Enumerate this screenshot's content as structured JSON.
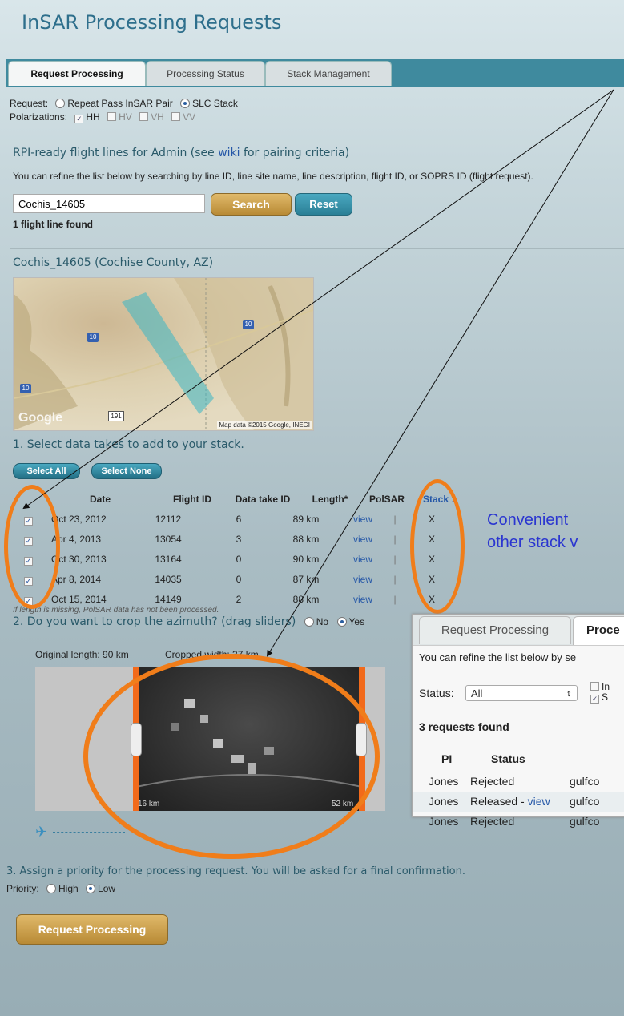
{
  "title": "InSAR Processing Requests",
  "tabs": [
    {
      "label": "Request Processing",
      "active": true
    },
    {
      "label": "Processing Status",
      "active": false
    },
    {
      "label": "Stack Management",
      "active": false
    }
  ],
  "request": {
    "label": "Request:",
    "options": [
      {
        "label": "Repeat Pass InSAR Pair",
        "selected": false
      },
      {
        "label": "SLC Stack",
        "selected": true
      }
    ]
  },
  "polarizations": {
    "label": "Polarizations:",
    "options": [
      {
        "label": "HH",
        "checked": true
      },
      {
        "label": "HV",
        "checked": false
      },
      {
        "label": "VH",
        "checked": false
      },
      {
        "label": "VV",
        "checked": false
      }
    ]
  },
  "flight_lines": {
    "heading_pre": "RPI-ready flight lines for Admin (see ",
    "heading_link": "wiki",
    "heading_post": " for pairing criteria)",
    "help": "You can refine the list below by searching by line ID, line site name, line description, flight ID, or SOPRS ID (flight request).",
    "search_value": "Cochis_14605",
    "search_label": "Search",
    "reset_label": "Reset",
    "found": "1 flight line found"
  },
  "line": {
    "heading": "Cochis_14605 (Cochise County, AZ)",
    "map_attribution": "Map data ©2015 Google, INEGI",
    "map_logo": "Google",
    "highway_10": "10",
    "highway_191": "191"
  },
  "step1": {
    "heading": "1. Select data takes to add to your stack.",
    "select_all": "Select All",
    "select_none": "Select None",
    "columns": [
      "Date",
      "Flight ID",
      "Data take ID",
      "Length*",
      "PolSAR",
      "Stack 1"
    ],
    "rows": [
      {
        "date": "Oct 23, 2012",
        "flight_id": "12112",
        "take_id": "6",
        "length": "89 km",
        "polsar": "view",
        "stack": "X"
      },
      {
        "date": "Apr 4, 2013",
        "flight_id": "13054",
        "take_id": "3",
        "length": "88 km",
        "polsar": "view",
        "stack": "X"
      },
      {
        "date": "Oct 30, 2013",
        "flight_id": "13164",
        "take_id": "0",
        "length": "90 km",
        "polsar": "view",
        "stack": "X"
      },
      {
        "date": "Apr 8, 2014",
        "flight_id": "14035",
        "take_id": "0",
        "length": "87 km",
        "polsar": "view",
        "stack": "X"
      },
      {
        "date": "Oct 15, 2014",
        "flight_id": "14149",
        "take_id": "2",
        "length": "88 km",
        "polsar": "view",
        "stack": "X"
      }
    ],
    "footnote": "If length is missing, PolSAR data has not been processed."
  },
  "step2": {
    "heading": "2. Do you want to crop the azimuth? (drag sliders)",
    "no": "No",
    "yes": "Yes",
    "original_length": "Original length: 90 km",
    "cropped_width": "Cropped width: 37 km",
    "left_mark": "16 km",
    "right_mark": "52 km"
  },
  "step3": {
    "heading": "3. Assign a priority for the processing request. You will be asked for a final confirmation.",
    "priority_label": "Priority:",
    "high": "High",
    "low": "Low",
    "submit": "Request Processing"
  },
  "annotation": {
    "line1": "Convenient",
    "line2": "other stack v",
    "color": "#f07d1a"
  },
  "overlay": {
    "tab1": "Request Processing",
    "tab2": "Proce",
    "help": "You can refine the list below by se",
    "status_label": "Status:",
    "status_value": "All",
    "check1": "In",
    "check2": "S",
    "found": "3 requests found",
    "col_pi": "PI",
    "col_status": "Status",
    "rows": [
      {
        "pi": "Jones",
        "status": "Rejected",
        "link": "",
        "site": "gulfco"
      },
      {
        "pi": "Jones",
        "status": "Released - ",
        "link": "view",
        "site": "gulfco"
      },
      {
        "pi": "Jones",
        "status": "Rejected",
        "link": "",
        "site": "gulfco"
      }
    ]
  }
}
